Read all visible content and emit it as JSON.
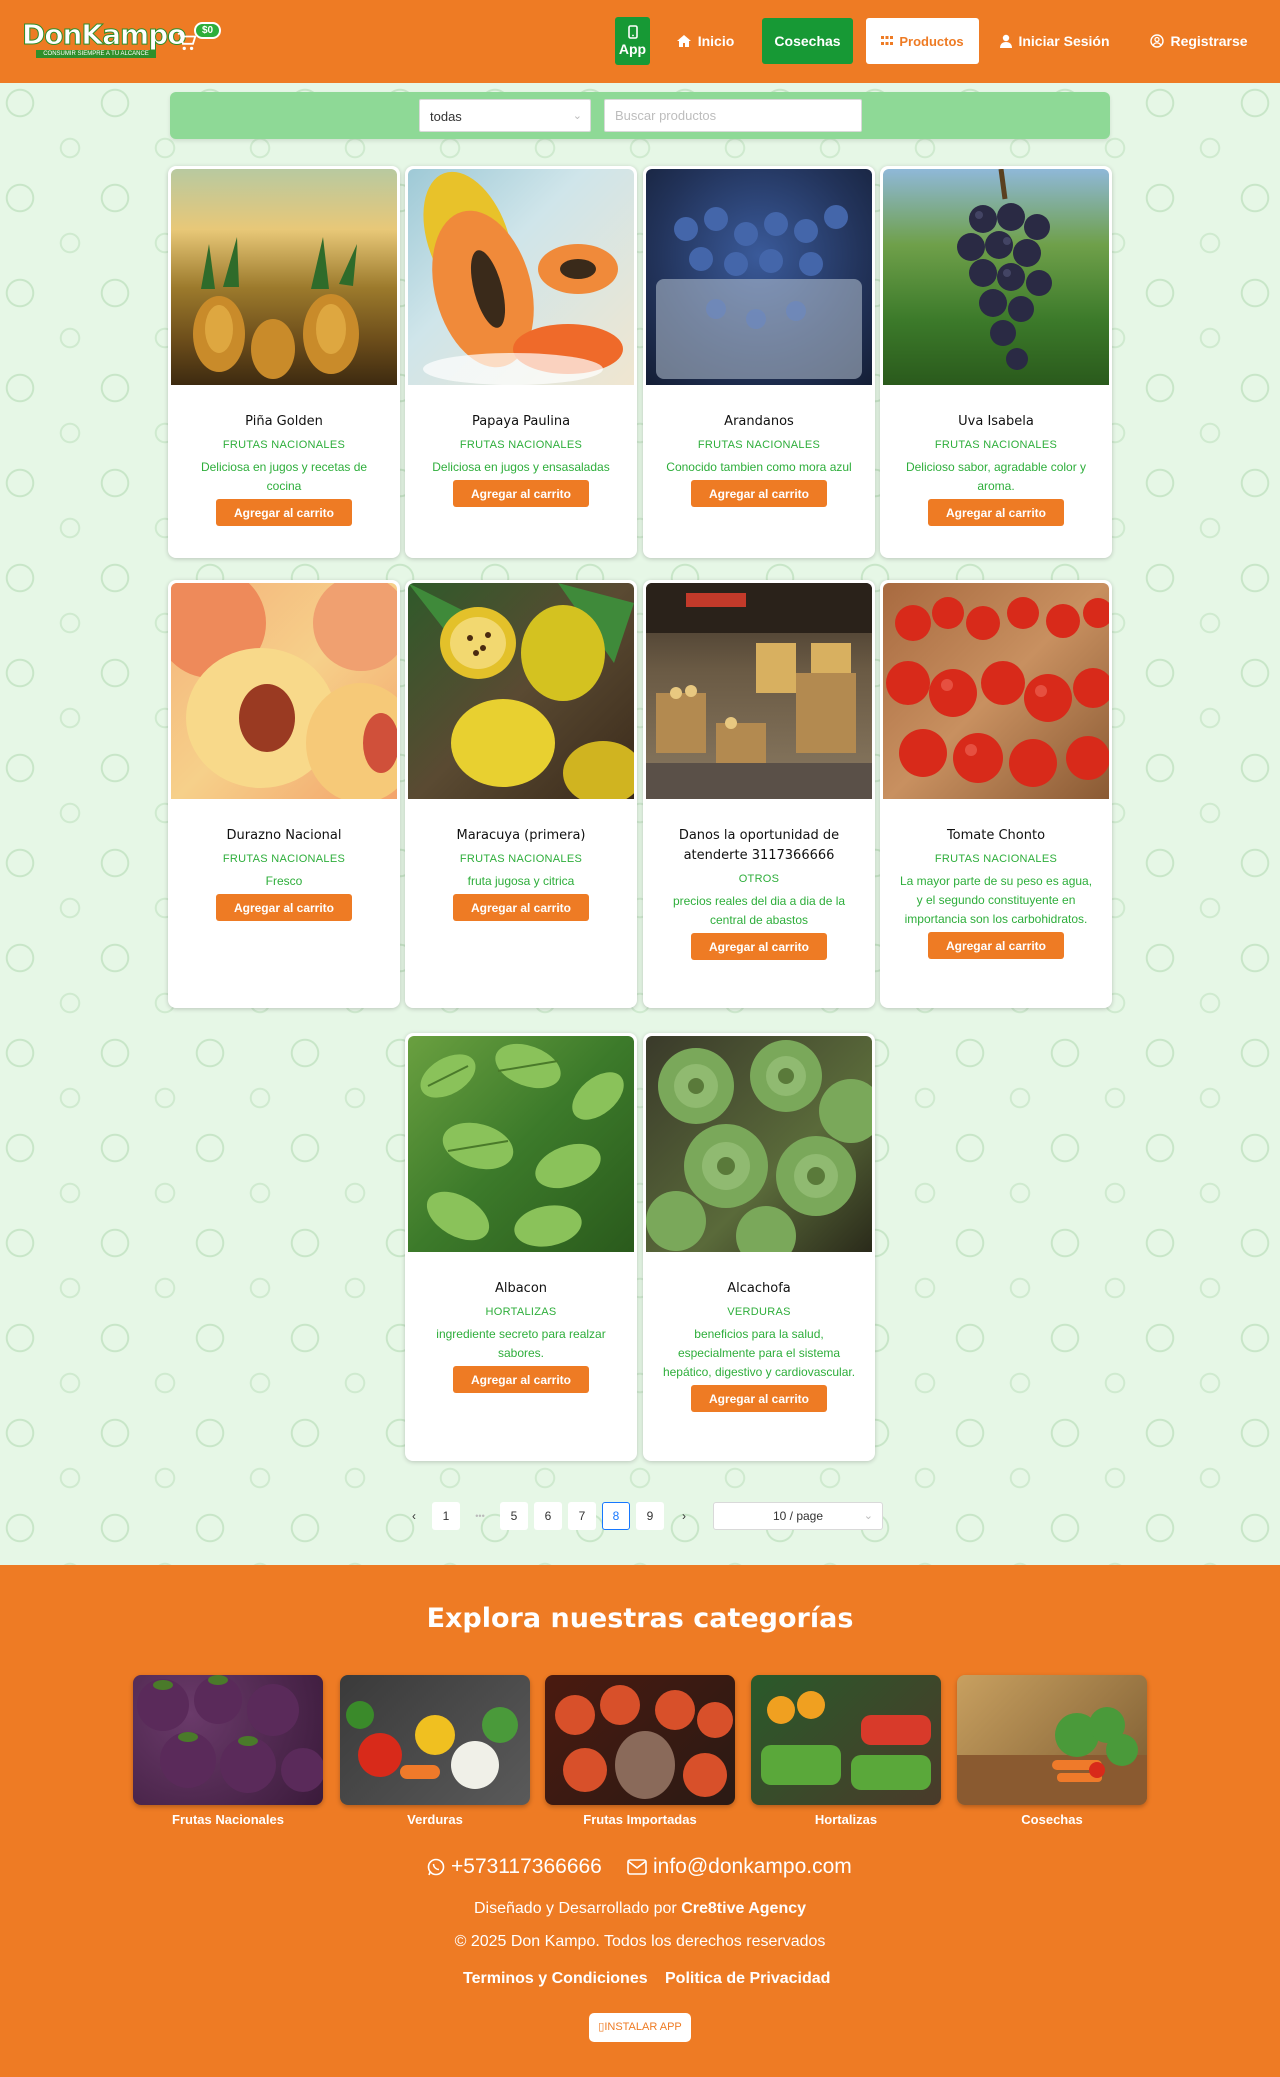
{
  "header": {
    "logo_text_1": "Don",
    "logo_text_2": "Kampo",
    "logo_tagline": "CONSUMIR SIEMPRE A TU ALCANCE",
    "cart_total": "$0",
    "nav": {
      "app": "App",
      "inicio": "Inicio",
      "cosechas": "Cosechas",
      "productos": "Productos",
      "login": "Iniciar Sesión",
      "register": "Registrarse"
    }
  },
  "filters": {
    "category_selected": "todas",
    "search_placeholder": "Buscar productos"
  },
  "products": [
    {
      "title": "Piña Golden",
      "category": "FRUTAS NACIONALES",
      "description": "Deliciosa en jugos y recetas de cocina",
      "button": "Agregar al carrito"
    },
    {
      "title": "Papaya Paulina",
      "category": "FRUTAS NACIONALES",
      "description": "Deliciosa en jugos y ensasaladas",
      "button": "Agregar al carrito"
    },
    {
      "title": "Arandanos",
      "category": "FRUTAS NACIONALES",
      "description": "Conocido tambien como mora azul",
      "button": "Agregar al carrito"
    },
    {
      "title": "Uva Isabela",
      "category": "FRUTAS NACIONALES",
      "description": "Delicioso sabor, agradable color y aroma.",
      "button": "Agregar al carrito"
    },
    {
      "title": "Durazno Nacional",
      "category": "FRUTAS NACIONALES",
      "description": "Fresco",
      "button": "Agregar al carrito"
    },
    {
      "title": "Maracuya (primera)",
      "category": "FRUTAS NACIONALES",
      "description": "fruta jugosa y citrica",
      "button": "Agregar al carrito"
    },
    {
      "title": "Danos la oportunidad de atenderte 3117366666",
      "category": "OTROS",
      "description": "precios reales del dia a dia de la central de abastos",
      "button": "Agregar al carrito"
    },
    {
      "title": "Tomate Chonto",
      "category": "FRUTAS NACIONALES",
      "description": "La mayor parte de su peso es agua, y el segundo constituyente en importancia son los carbohidratos.",
      "button": "Agregar al carrito"
    },
    {
      "title": "Albacon",
      "category": "HORTALIZAS",
      "description": "ingrediente secreto para realzar sabores.",
      "button": "Agregar al carrito"
    },
    {
      "title": "Alcachofa",
      "category": "VERDURAS",
      "description": "beneficios para la salud, especialmente para el sistema hepático, digestivo y cardiovascular.",
      "button": "Agregar al carrito"
    }
  ],
  "pagination": {
    "prev": "‹",
    "next": "›",
    "ellipsis": "•••",
    "pages": [
      "1",
      "5",
      "6",
      "7",
      "8",
      "9"
    ],
    "current": "8",
    "page_size": "10 / page"
  },
  "footer": {
    "title": "Explora nuestras categorías",
    "categories": [
      "Frutas Nacionales",
      "Verduras",
      "Frutas Importadas",
      "Hortalizas",
      "Cosechas"
    ],
    "phone": "+573117366666",
    "email": "info@donkampo.com",
    "credit_prefix": "Diseñado y Desarrollado por",
    "credit_agency": "Cre8tive Agency",
    "copyright": "© 2025 Don Kampo. Todos los derechos reservados",
    "terms": "Terminos y Condiciones",
    "privacy": "Politica de Privacidad",
    "install": "INSTALAR APP"
  },
  "colors": {
    "brand_orange": "#ee7b24",
    "brand_green": "#179935",
    "text_green": "#2eae3b",
    "filter_bar": "#8ed996",
    "background": "#e6f6e6"
  },
  "icons": [
    "cart-icon",
    "phone-icon",
    "home-icon",
    "user-icon",
    "user-circle-icon",
    "grid-icon",
    "whatsapp-icon",
    "mail-icon",
    "mobile-icon"
  ]
}
